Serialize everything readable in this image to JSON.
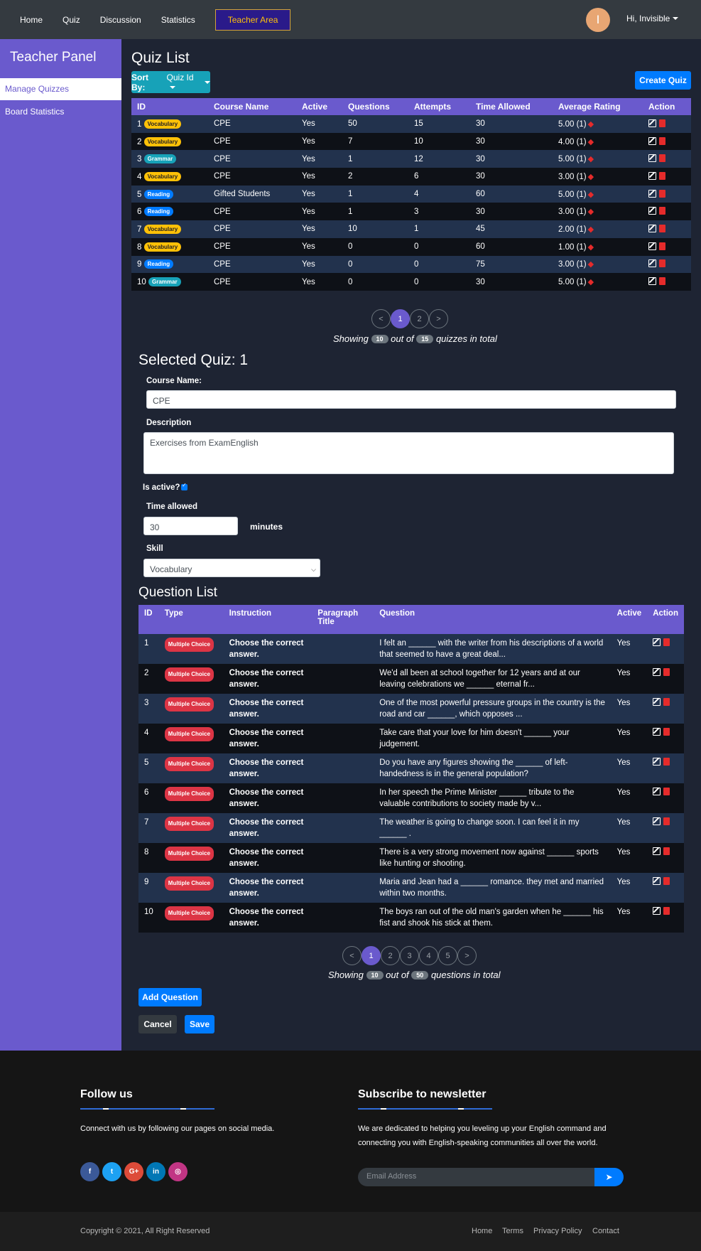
{
  "nav": {
    "items": [
      "Home",
      "Quiz",
      "Discussion",
      "Statistics"
    ],
    "teacher_area": "Teacher Area",
    "avatar_letter": "I",
    "user_greeting": "Hi, Invisible"
  },
  "sidebar": {
    "title": "Teacher Panel",
    "items": [
      "Manage Quizzes",
      "Board Statistics"
    ]
  },
  "quiz_list": {
    "title": "Quiz List",
    "sort_prefix": "Sort By:",
    "sort_value": "Quiz Id",
    "create_label": "Create Quiz",
    "headers": [
      "ID",
      "Course Name",
      "Active",
      "Questions",
      "Attempts",
      "Time Allowed",
      "Average Rating",
      "Action"
    ],
    "rows": [
      {
        "id": "1",
        "skill": "Vocabulary",
        "course": "CPE",
        "active": "Yes",
        "questions": "50",
        "attempts": "15",
        "time": "30",
        "rating": "5.00 (1)"
      },
      {
        "id": "2",
        "skill": "Vocabulary",
        "course": "CPE",
        "active": "Yes",
        "questions": "7",
        "attempts": "10",
        "time": "30",
        "rating": "4.00 (1)"
      },
      {
        "id": "3",
        "skill": "Grammar",
        "course": "CPE",
        "active": "Yes",
        "questions": "1",
        "attempts": "12",
        "time": "30",
        "rating": "5.00 (1)"
      },
      {
        "id": "4",
        "skill": "Vocabulary",
        "course": "CPE",
        "active": "Yes",
        "questions": "2",
        "attempts": "6",
        "time": "30",
        "rating": "3.00 (1)"
      },
      {
        "id": "5",
        "skill": "Reading",
        "course": "Gifted Students",
        "active": "Yes",
        "questions": "1",
        "attempts": "4",
        "time": "60",
        "rating": "5.00 (1)"
      },
      {
        "id": "6",
        "skill": "Reading",
        "course": "CPE",
        "active": "Yes",
        "questions": "1",
        "attempts": "3",
        "time": "30",
        "rating": "3.00 (1)"
      },
      {
        "id": "7",
        "skill": "Vocabulary",
        "course": "CPE",
        "active": "Yes",
        "questions": "10",
        "attempts": "1",
        "time": "45",
        "rating": "2.00 (1)"
      },
      {
        "id": "8",
        "skill": "Vocabulary",
        "course": "CPE",
        "active": "Yes",
        "questions": "0",
        "attempts": "0",
        "time": "60",
        "rating": "1.00 (1)"
      },
      {
        "id": "9",
        "skill": "Reading",
        "course": "CPE",
        "active": "Yes",
        "questions": "0",
        "attempts": "0",
        "time": "75",
        "rating": "3.00 (1)"
      },
      {
        "id": "10",
        "skill": "Grammar",
        "course": "CPE",
        "active": "Yes",
        "questions": "0",
        "attempts": "0",
        "time": "30",
        "rating": "5.00 (1)"
      }
    ],
    "pages": [
      "<",
      "1",
      "2",
      ">"
    ],
    "active_page": "1",
    "showing": {
      "pre": "Showing",
      "count": "10",
      "mid": "out of",
      "total": "15",
      "post": "quizzes in total"
    }
  },
  "selected_quiz": {
    "title": "Selected Quiz: 1",
    "course_label": "Course Name:",
    "course_value": "CPE",
    "description_label": "Description",
    "description_value": "Exercises from ExamEnglish",
    "active_label": "Is active?",
    "time_label": "Time allowed",
    "time_value": "30",
    "time_unit": "minutes",
    "skill_label": "Skill",
    "skill_value": "Vocabulary"
  },
  "question_list": {
    "title": "Question List",
    "headers": [
      "ID",
      "Type",
      "Instruction",
      "Paragraph Title",
      "Question",
      "Active",
      "Action"
    ],
    "rows": [
      {
        "id": "1",
        "type": "Multiple Choice",
        "instruction": "Choose the correct answer.",
        "paragraph": "",
        "question": "I felt an ______ with the writer from his descriptions of a world that seemed to have a great deal...",
        "active": "Yes"
      },
      {
        "id": "2",
        "type": "Multiple Choice",
        "instruction": "Choose the correct answer.",
        "paragraph": "",
        "question": "We'd all been at school together for 12 years and at our leaving celebrations we ______ eternal fr...",
        "active": "Yes"
      },
      {
        "id": "3",
        "type": "Multiple Choice",
        "instruction": "Choose the correct answer.",
        "paragraph": "",
        "question": "One of the most powerful pressure groups in the country is the road and car ______, which opposes ...",
        "active": "Yes"
      },
      {
        "id": "4",
        "type": "Multiple Choice",
        "instruction": "Choose the correct answer.",
        "paragraph": "",
        "question": "Take care that your love for him doesn't ______ your judgement.",
        "active": "Yes"
      },
      {
        "id": "5",
        "type": "Multiple Choice",
        "instruction": "Choose the correct answer.",
        "paragraph": "",
        "question": "Do you have any figures showing the ______ of left-handedness is in the general population?",
        "active": "Yes"
      },
      {
        "id": "6",
        "type": "Multiple Choice",
        "instruction": "Choose the correct answer.",
        "paragraph": "",
        "question": "In her speech the Prime Minister ______ tribute to the valuable contributions to society made by v...",
        "active": "Yes"
      },
      {
        "id": "7",
        "type": "Multiple Choice",
        "instruction": "Choose the correct answer.",
        "paragraph": "",
        "question": "The weather is going to change soon. I can feel it in my ______ .",
        "active": "Yes"
      },
      {
        "id": "8",
        "type": "Multiple Choice",
        "instruction": "Choose the correct answer.",
        "paragraph": "",
        "question": "There is a very strong movement now against ______ sports like hunting or shooting.",
        "active": "Yes"
      },
      {
        "id": "9",
        "type": "Multiple Choice",
        "instruction": "Choose the correct answer.",
        "paragraph": "",
        "question": "Maria and Jean had a ______ romance. they met and married within two months.",
        "active": "Yes"
      },
      {
        "id": "10",
        "type": "Multiple Choice",
        "instruction": "Choose the correct answer.",
        "paragraph": "",
        "question": "The boys ran out of the old man's garden when he ______ his fist and shook his stick at them.",
        "active": "Yes"
      }
    ],
    "pages": [
      "<",
      "1",
      "2",
      "3",
      "4",
      "5",
      ">"
    ],
    "active_page": "1",
    "showing": {
      "pre": "Showing",
      "count": "10",
      "mid": "out of",
      "total": "50",
      "post": "questions in total"
    },
    "add_label": "Add Question",
    "cancel_label": "Cancel",
    "save_label": "Save"
  },
  "footer": {
    "follow_title": "Follow us",
    "follow_text": "Connect with us by following our pages on social media.",
    "social_icons": [
      "facebook-icon",
      "twitter-icon",
      "google-plus-icon",
      "linkedin-icon",
      "instagram-icon"
    ],
    "social_glyphs": [
      "f",
      "t",
      "G+",
      "in",
      "◎"
    ],
    "social_colors": [
      "#3b5998",
      "#1da1f2",
      "#dd4b39",
      "#0077b5",
      "#c13584"
    ],
    "newsletter_title": "Subscribe to newsletter",
    "newsletter_text": "We are dedicated to helping you leveling up your English command and connecting you with English-speaking communities all over the world.",
    "email_placeholder": "Email Address",
    "copyright": "Copyright © 2021, All Right Reserved",
    "links": [
      "Home",
      "Terms",
      "Privacy Policy",
      "Contact"
    ]
  },
  "colors": {
    "accent": "#6a5acd",
    "primary": "#007bff",
    "info": "#17a2b8",
    "warning": "#ffc107",
    "danger": "#dc3545"
  }
}
